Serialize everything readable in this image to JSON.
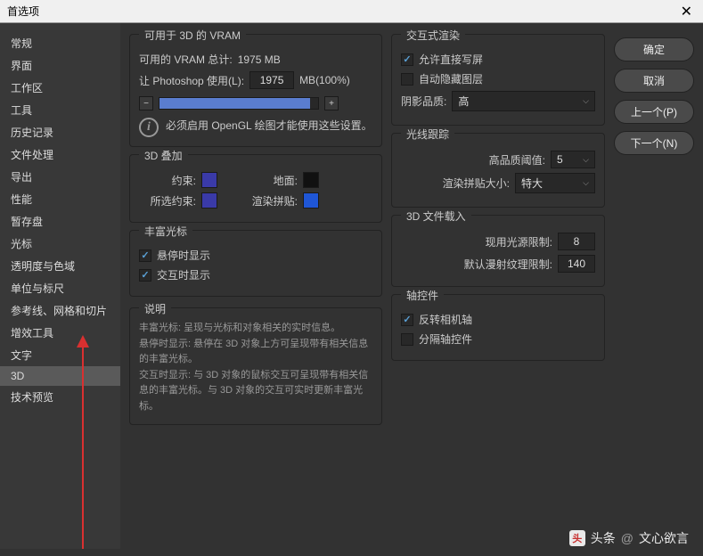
{
  "titlebar": {
    "title": "首选项",
    "close": "✕"
  },
  "sidebar": {
    "items": [
      {
        "label": "常规"
      },
      {
        "label": "界面"
      },
      {
        "label": "工作区"
      },
      {
        "label": "工具"
      },
      {
        "label": "历史记录"
      },
      {
        "label": "文件处理"
      },
      {
        "label": "导出"
      },
      {
        "label": "性能"
      },
      {
        "label": "暂存盘"
      },
      {
        "label": "光标"
      },
      {
        "label": "透明度与色域"
      },
      {
        "label": "单位与标尺"
      },
      {
        "label": "参考线、网格和切片"
      },
      {
        "label": "增效工具"
      },
      {
        "label": "文字"
      },
      {
        "label": "3D",
        "selected": true
      },
      {
        "label": "技术预览"
      }
    ]
  },
  "buttons": {
    "ok": "确定",
    "cancel": "取消",
    "prev": "上一个(P)",
    "next": "下一个(N)"
  },
  "vram": {
    "title": "可用于 3D 的 VRAM",
    "total_label": "可用的 VRAM 总计:",
    "total_value": "1975 MB",
    "usage_label": "让 Photoshop 使用(L):",
    "usage_value": "1975",
    "usage_suffix": "MB(100%)",
    "minus": "−",
    "plus": "+",
    "info": "必须启用 OpenGL 绘图才能使用这些设置。"
  },
  "overlay": {
    "title": "3D 叠加",
    "constraint": "约束:",
    "ground": "地面:",
    "all_constraint": "所选约束:",
    "render_tile": "渲染拼贴:",
    "colors": {
      "constraint": "#3a3aa8",
      "ground": "#111",
      "all_constraint": "#3a3aa8",
      "render_tile": "#1f56d6"
    }
  },
  "cursor": {
    "title": "丰富光标",
    "hover": "悬停时显示",
    "interact": "交互时显示"
  },
  "interactive": {
    "title": "交互式渲染",
    "direct": "允许直接写屏",
    "autohide": "自动隐藏图层",
    "shadow_label": "阴影品质:",
    "shadow_value": "高"
  },
  "raytrace": {
    "title": "光线跟踪",
    "threshold_label": "高品质阈值:",
    "threshold_value": "5",
    "tile_label": "渲染拼贴大小:",
    "tile_value": "特大"
  },
  "fileload": {
    "title": "3D 文件载入",
    "light_label": "现用光源限制:",
    "light_value": "8",
    "texture_label": "默认漫射纹理限制:",
    "texture_value": "140"
  },
  "axis": {
    "title": "轴控件",
    "invert": "反转相机轴",
    "separate": "分隔轴控件"
  },
  "desc": {
    "title": "说明",
    "l1": "丰富光标: 呈现与光标和对象相关的实时信息。",
    "l2": "悬停时显示: 悬停在 3D 对象上方可呈现带有相关信息的丰富光标。",
    "l3": "交互时显示: 与 3D 对象的鼠标交互可呈现带有相关信息的丰富光标。与 3D 对象的交互可实时更新丰富光标。"
  },
  "watermark": {
    "prefix": "头条",
    "at": "@",
    "name": "文心欲言"
  }
}
